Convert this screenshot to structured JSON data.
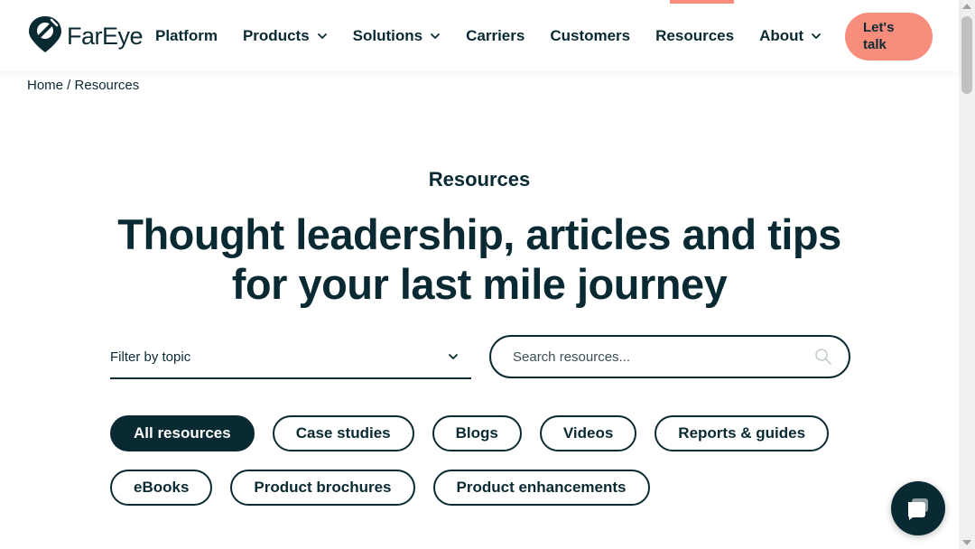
{
  "header": {
    "logo_text": "FarEye",
    "nav": [
      {
        "label": "Platform",
        "has_dropdown": false
      },
      {
        "label": "Products",
        "has_dropdown": true
      },
      {
        "label": "Solutions",
        "has_dropdown": true
      },
      {
        "label": "Carriers",
        "has_dropdown": false
      },
      {
        "label": "Customers",
        "has_dropdown": false
      },
      {
        "label": "Resources",
        "has_dropdown": false
      },
      {
        "label": "About",
        "has_dropdown": true
      }
    ],
    "cta_line1": "Let's",
    "cta_line2": "talk"
  },
  "breadcrumb": {
    "home": "Home",
    "separator": " / ",
    "current": "Resources"
  },
  "hero": {
    "eyebrow": "Resources",
    "headline_line1": "Thought leadership, articles and tips",
    "headline_line2": "for your last mile journey"
  },
  "filters": {
    "topic_label": "Filter by topic",
    "search_placeholder": "Search resources...",
    "search_value": ""
  },
  "pills": [
    {
      "label": "All resources",
      "active": true
    },
    {
      "label": "Case studies",
      "active": false
    },
    {
      "label": "Blogs",
      "active": false
    },
    {
      "label": "Videos",
      "active": false
    },
    {
      "label": "Reports & guides",
      "active": false
    },
    {
      "label": "eBooks",
      "active": false
    },
    {
      "label": "Product brochures",
      "active": false
    },
    {
      "label": "Product enhancements",
      "active": false
    }
  ],
  "icons": {
    "logo": "map-pin-logo-icon",
    "dropdown": "chevron-down-icon",
    "search": "search-icon",
    "chat": "chat-bubble-icon"
  },
  "colors": {
    "primary": "#0a2a33",
    "accent": "#f98d7c",
    "background": "#ffffff"
  }
}
